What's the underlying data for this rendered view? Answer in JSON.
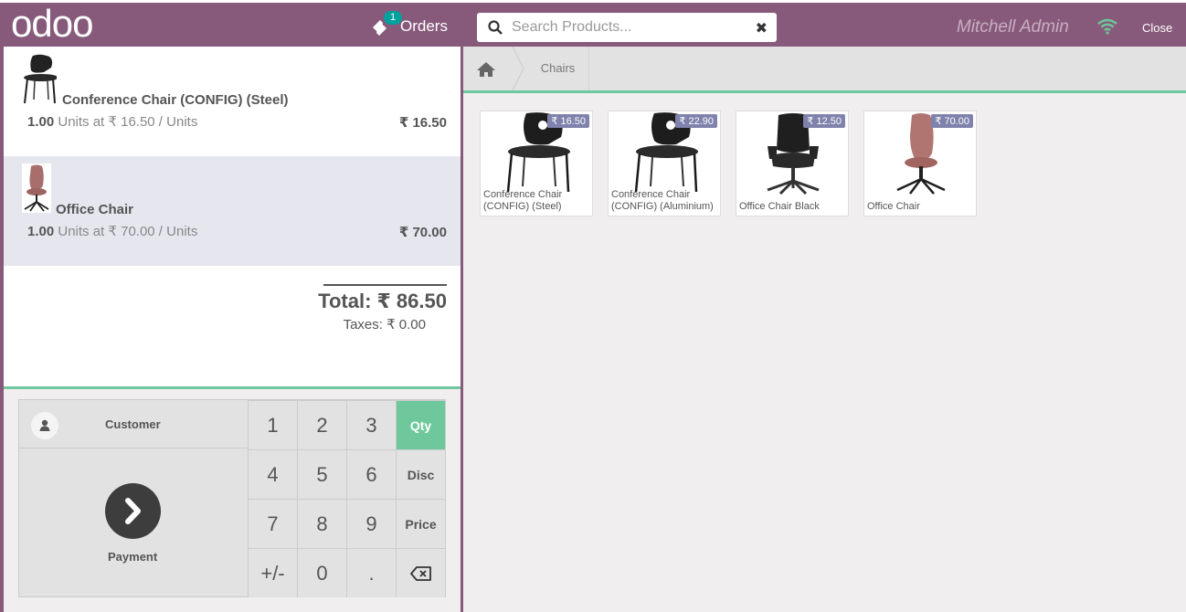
{
  "header": {
    "logo_text": "odoo",
    "orders_label": "Orders",
    "orders_count": "1",
    "search_placeholder": "Search Products...",
    "user_name": "Mitchell Admin",
    "close_label": "Close"
  },
  "order": {
    "lines": [
      {
        "name": "Conference Chair (CONFIG) (Steel)",
        "qty": "1.00",
        "unit_info": "Units at ₹ 16.50 / Units",
        "price": "₹ 16.50"
      },
      {
        "name": "Office Chair",
        "qty": "1.00",
        "unit_info": "Units at ₹ 70.00 / Units",
        "price": "₹ 70.00"
      }
    ],
    "total": "Total: ₹ 86.50",
    "taxes": "Taxes: ₹ 0.00"
  },
  "actions": {
    "customer_label": "Customer",
    "payment_label": "Payment"
  },
  "numpad": {
    "keys": [
      "1",
      "2",
      "3",
      "4",
      "5",
      "6",
      "7",
      "8",
      "9",
      "+/-",
      "0",
      "."
    ],
    "qty": "Qty",
    "disc": "Disc",
    "price": "Price"
  },
  "breadcrumb": {
    "category": "Chairs"
  },
  "products": [
    {
      "name": "Conference Chair (CONFIG) (Steel)",
      "price": "₹ 16.50"
    },
    {
      "name": "Conference Chair (CONFIG) (Aluminium)",
      "price": "₹ 22.90"
    },
    {
      "name": "Office Chair Black",
      "price": "₹ 12.50"
    },
    {
      "name": "Office Chair",
      "price": "₹ 70.00"
    }
  ],
  "colors": {
    "header": "#875a7b",
    "accent_green": "#6ec89b",
    "price_tag": "#7f82ac",
    "selected_line": "#e6e6ef"
  }
}
